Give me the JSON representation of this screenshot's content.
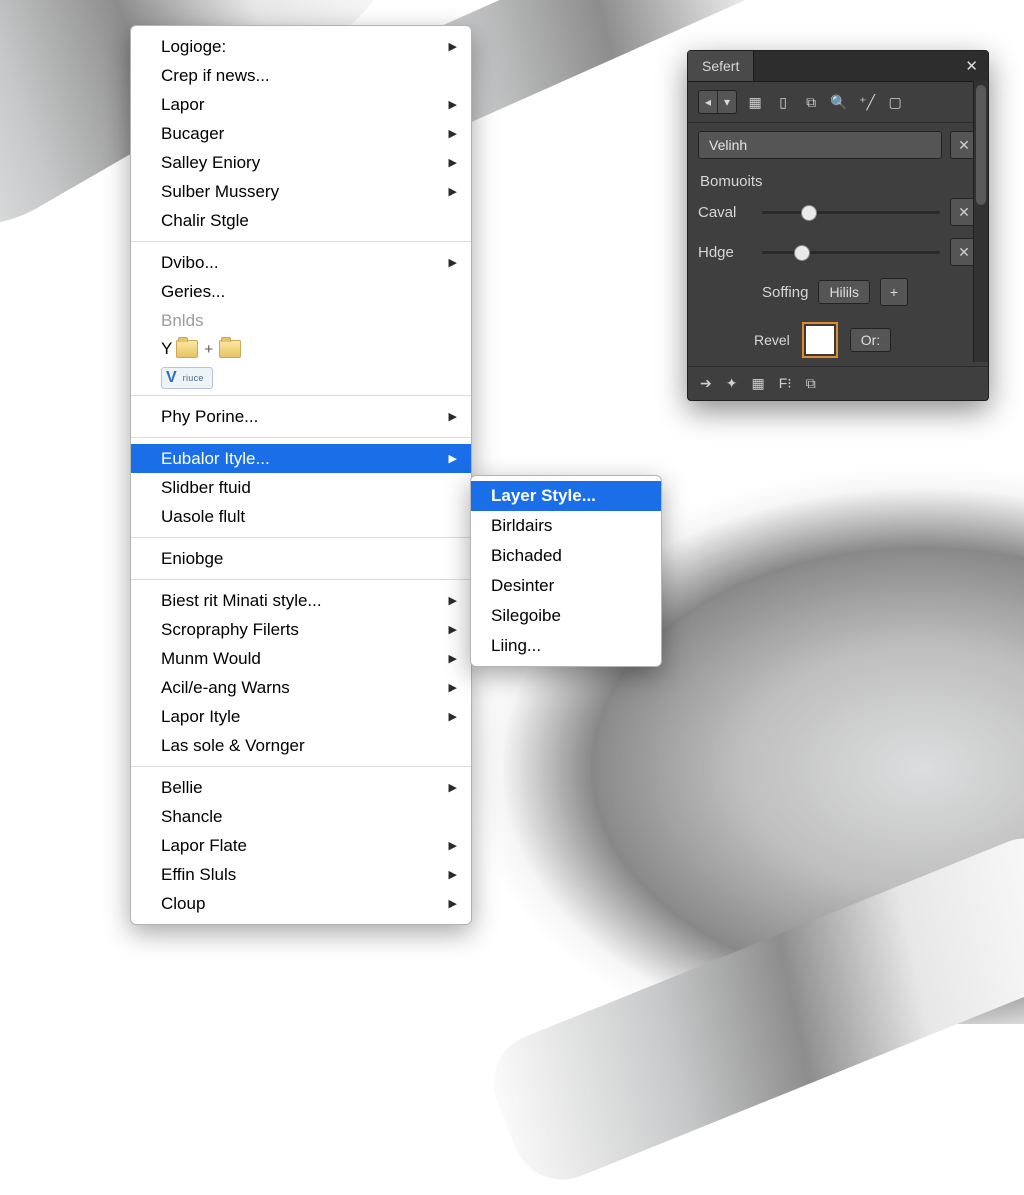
{
  "menu": {
    "group1": [
      {
        "label": "Logioge:",
        "sub": true
      },
      {
        "label": "Crep if news..."
      },
      {
        "label": "Lapor",
        "sub": true
      },
      {
        "label": "Bucager",
        "sub": true
      },
      {
        "label": "Salley Eniory",
        "sub": true
      },
      {
        "label": "Sulber Mussery",
        "sub": true
      },
      {
        "label": "Chalir Stgle"
      }
    ],
    "group2": [
      {
        "label": "Dvibo...",
        "sub": true
      },
      {
        "label": "Geries..."
      },
      {
        "label": "Bnlds",
        "disabled": true
      }
    ],
    "y_label": "Y",
    "chip_letter": "V",
    "chip_label": "riuce",
    "group3": [
      {
        "label": "Phy Porine...",
        "sub": true
      }
    ],
    "group4": [
      {
        "label": "Eubalor Ityle...",
        "sub": true,
        "selected": true
      },
      {
        "label": "Slidber ftuid"
      },
      {
        "label": "Uasole flult"
      }
    ],
    "group5": [
      {
        "label": "Eniobge"
      }
    ],
    "group6": [
      {
        "label": "Biest rit Minati style...",
        "sub": true
      },
      {
        "label": "Scropraphy Filerts",
        "sub": true
      },
      {
        "label": "Munm Would",
        "sub": true
      },
      {
        "label": "Acil/e-ang Warns",
        "sub": true
      },
      {
        "label": "Lapor Ityle",
        "sub": true
      },
      {
        "label": "Las sole & Vornger"
      }
    ],
    "group7": [
      {
        "label": "Bellie",
        "sub": true
      },
      {
        "label": "Shancle"
      },
      {
        "label": "Lapor Flate",
        "sub": true
      },
      {
        "label": "Effin Sluls",
        "sub": true
      },
      {
        "label": "Cloup",
        "sub": true
      }
    ]
  },
  "submenu": {
    "items": [
      {
        "label": "Layer Style...",
        "selected": true
      },
      {
        "label": "Birldairs"
      },
      {
        "label": "Bichaded"
      },
      {
        "label": "Desinter"
      },
      {
        "label": "Silegoibe"
      },
      {
        "label": "Liing..."
      }
    ]
  },
  "panel": {
    "title": "Sefert",
    "search_value": "Velinh",
    "section": "Bomuoits",
    "slider1_label": "Caval",
    "slider2_label": "Hdge",
    "soffing_label": "Soffing",
    "soffing_btn": "Hilils",
    "revel_label": "Revel",
    "revel_btn": "Or:",
    "toolbar_icons": [
      "calendar-icon",
      "panel-icon",
      "layout-icon",
      "search-icon",
      "wand-icon",
      "device-icon"
    ],
    "footer_icons": [
      "arrow-right-icon",
      "pointer-icon",
      "grid-icon",
      "fit-icon",
      "copy-icon"
    ]
  }
}
